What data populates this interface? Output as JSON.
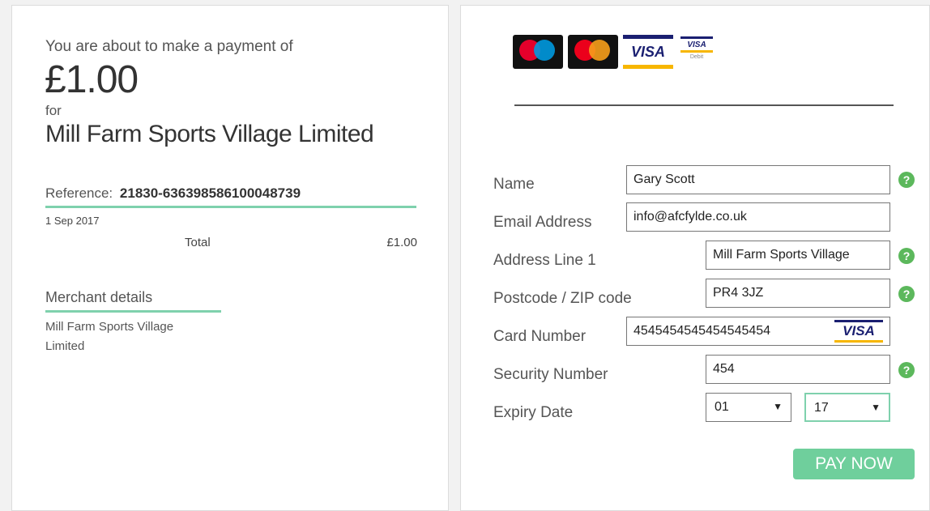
{
  "summary": {
    "intro": "You are about to make a payment of",
    "amount": "£1.00",
    "for_label": "for",
    "merchant_name": "Mill Farm Sports Village Limited",
    "reference_label": "Reference:",
    "reference_value": "21830-636398586100048739",
    "date": "1 Sep 2017",
    "total_label": "Total",
    "total_value": "£1.00",
    "merchant_details_heading": "Merchant details",
    "merchant_details_text": "Mill Farm Sports Village Limited"
  },
  "card_logos": {
    "visa_text": "VISA",
    "visa_debit_text": "VISA",
    "debit_label": "Debit"
  },
  "form": {
    "name_label": "Name",
    "name_value": "Gary Scott",
    "email_label": "Email Address",
    "email_value": "info@afcfylde.co.uk",
    "address_label": "Address Line 1",
    "address_value": "Mill Farm Sports Village",
    "postcode_label": "Postcode / ZIP code",
    "postcode_value": "PR4 3JZ",
    "card_label": "Card Number",
    "card_value": "4545454545454545454",
    "card_brand": "VISA",
    "security_label": "Security Number",
    "security_value": "454",
    "expiry_label": "Expiry Date",
    "expiry_month": "01",
    "expiry_year": "17",
    "help_glyph": "?",
    "pay_button": "PAY NOW"
  },
  "colors": {
    "accent_green": "#7fd1ad",
    "button_green": "#6fcf9c",
    "help_green": "#5cb85c",
    "visa_blue": "#1a1f71",
    "visa_gold": "#f7b600"
  }
}
